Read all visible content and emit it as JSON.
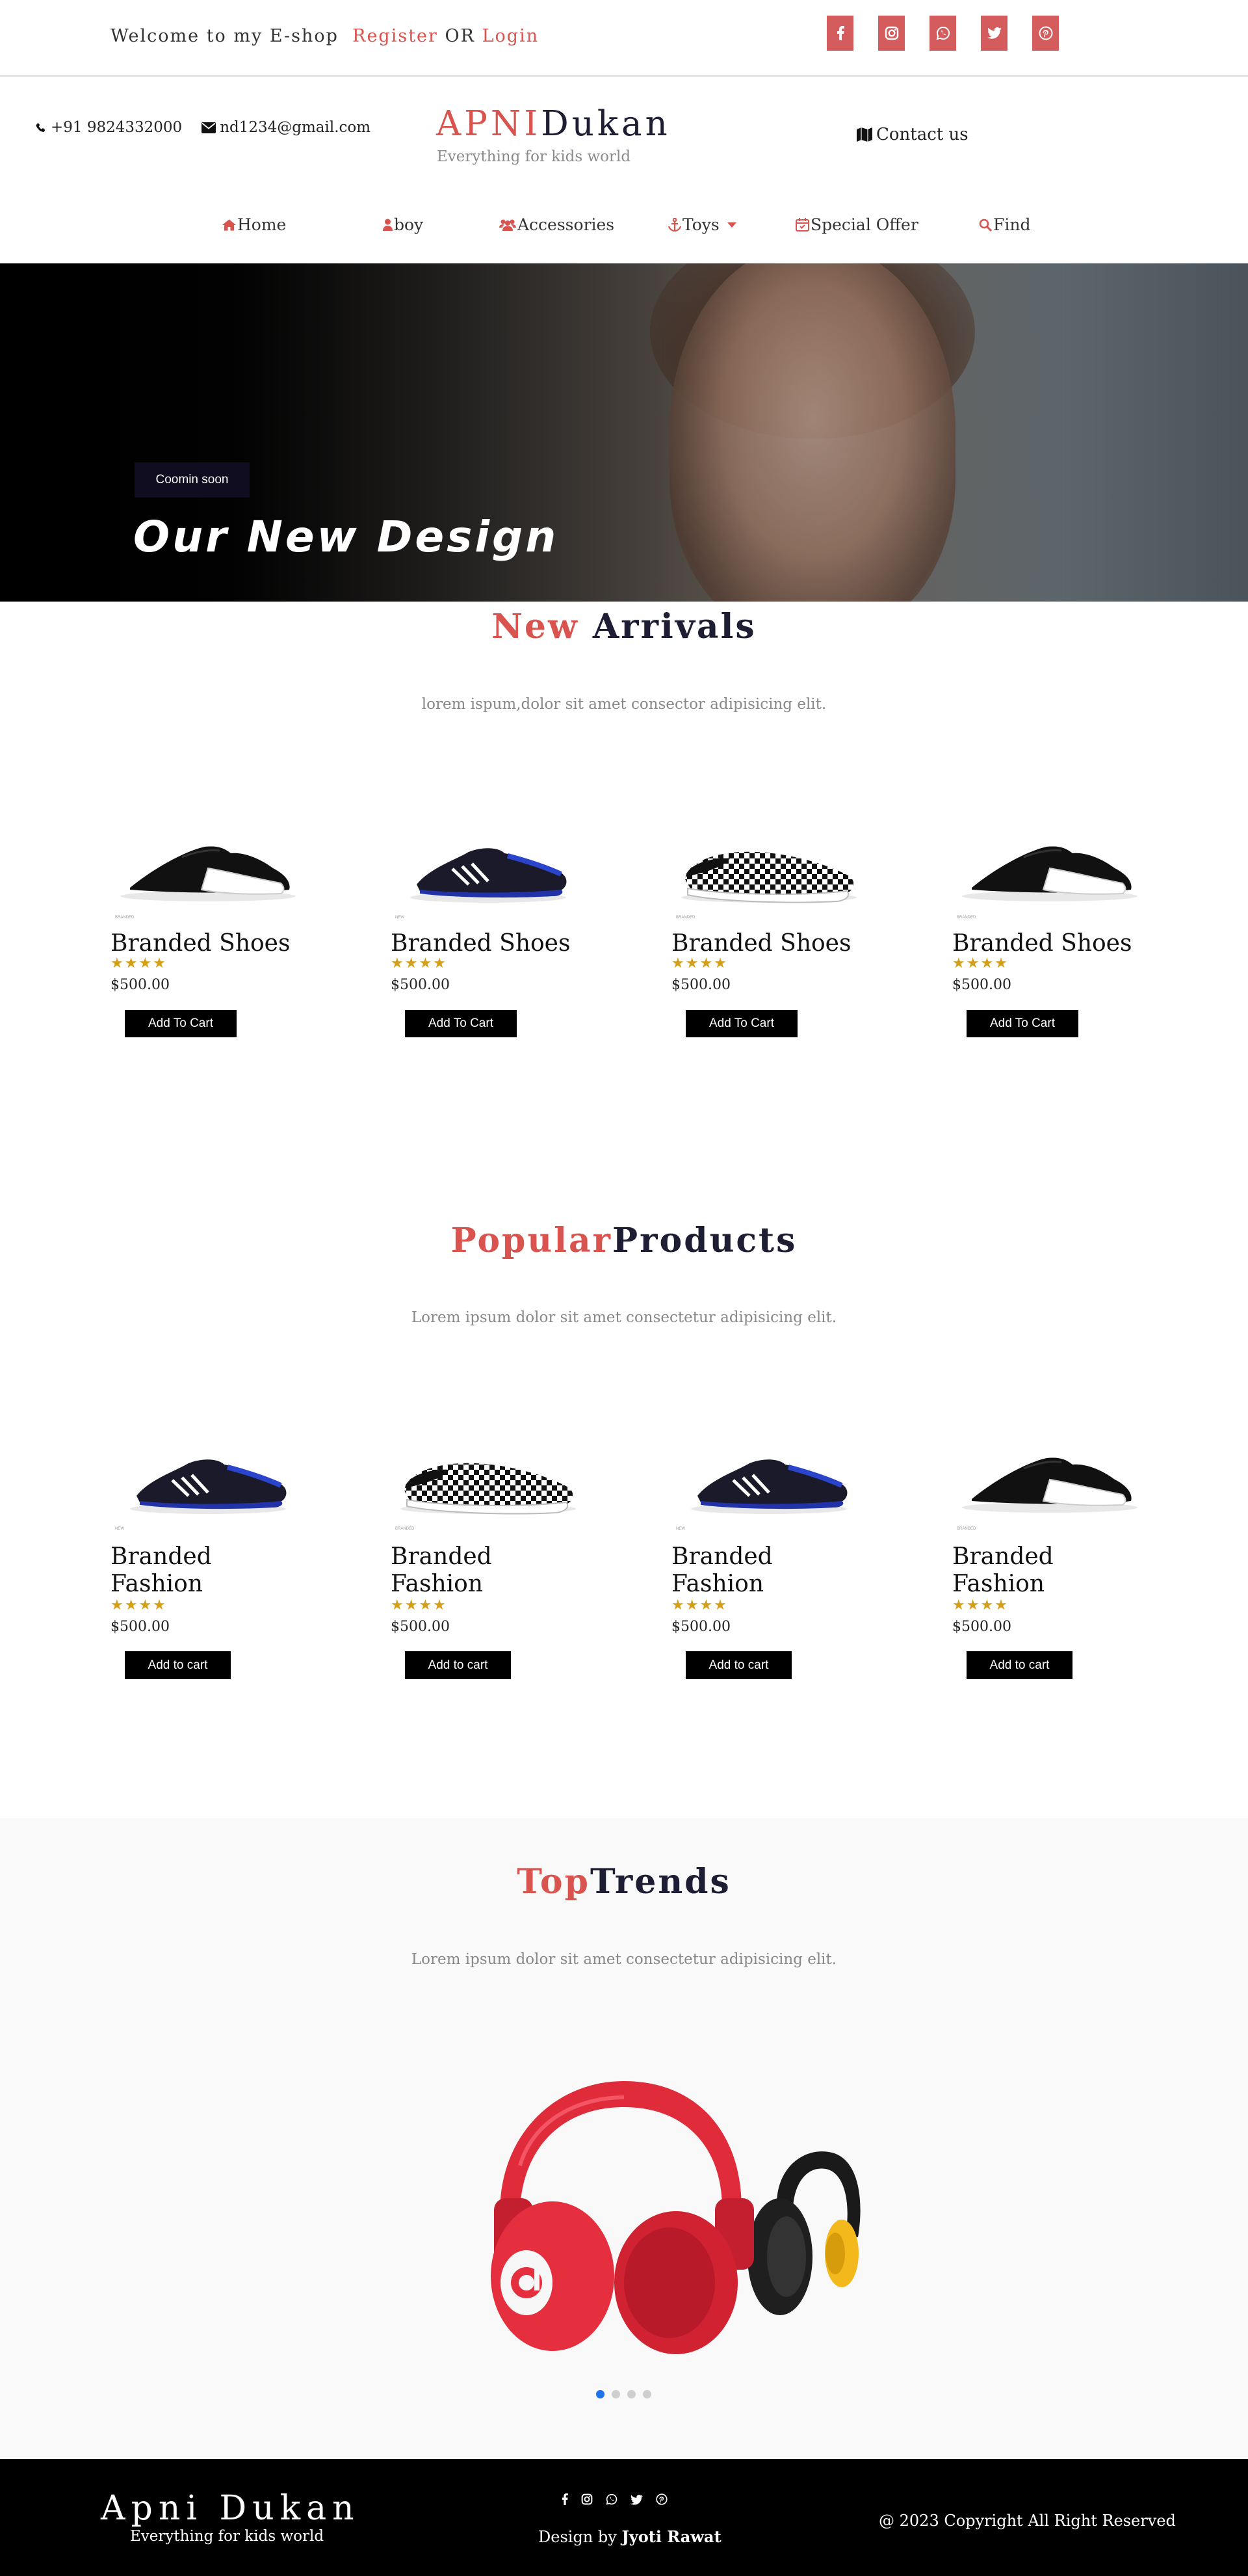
{
  "topbar": {
    "welcome": "Welcome to my E-shop",
    "register": "Register",
    "or": "OR",
    "login": "Login",
    "social_icons": [
      "facebook-icon",
      "instagram-icon",
      "whatsapp-icon",
      "twitter-icon",
      "pinterest-icon"
    ],
    "accent_color": "#d45c5c"
  },
  "header": {
    "phone": "+91 9824332000",
    "email": "nd1234@gmail.com",
    "logo_part1": "APNI",
    "logo_part2": "Dukan",
    "tagline": "Everything for kids world",
    "contact": "Contact us"
  },
  "nav": {
    "items": [
      {
        "label": "Home",
        "icon": "home-icon"
      },
      {
        "label": "boy",
        "icon": "user-icon"
      },
      {
        "label": "Accessories",
        "icon": "users-icon"
      },
      {
        "label": "Toys",
        "icon": "anchor-icon"
      },
      {
        "label": "Special Offer",
        "icon": "calendar-icon"
      },
      {
        "label": "Find",
        "icon": "search-icon"
      }
    ]
  },
  "hero": {
    "badge": "Coomin soon",
    "headline": "Our New Design"
  },
  "new_arrivals": {
    "title_a": "New",
    "title_b": " Arrivals",
    "subtitle": "lorem ispum,dolor sit amet consector adipisicing elit.",
    "products": [
      {
        "name": "Branded Shoes",
        "price": "$500.00",
        "button": "Add To Cart",
        "rating": 4,
        "image": "black-slipon-shoe"
      },
      {
        "name": "Branded Shoes",
        "price": "$500.00",
        "button": "Add To Cart",
        "rating": 4,
        "image": "blue-sneaker"
      },
      {
        "name": "Branded Shoes",
        "price": "$500.00",
        "button": "Add To Cart",
        "rating": 4,
        "image": "checkered-slipon"
      },
      {
        "name": "Branded Shoes",
        "price": "$500.00",
        "button": "Add To Cart",
        "rating": 4,
        "image": "black-slipon-shoe"
      }
    ]
  },
  "popular": {
    "title_a": "Popular",
    "title_b": "Products",
    "subtitle": "Lorem ipsum dolor sit amet consectetur adipisicing elit.",
    "products": [
      {
        "name_line1": "Branded",
        "name_line2": "Fashion",
        "price": "$500.00",
        "button": "Add to cart",
        "rating": 4,
        "image": "blue-sneaker"
      },
      {
        "name_line1": "Branded",
        "name_line2": "Fashion",
        "price": "$500.00",
        "button": "Add to cart",
        "rating": 4,
        "image": "checkered-slipon"
      },
      {
        "name_line1": "Branded",
        "name_line2": "Fashion",
        "price": "$500.00",
        "button": "Add to cart",
        "rating": 4,
        "image": "blue-sneaker"
      },
      {
        "name_line1": "Branded",
        "name_line2": "Fashion",
        "price": "$500.00",
        "button": "Add to cart",
        "rating": 4,
        "image": "black-slipon-shoe"
      }
    ]
  },
  "trends": {
    "title_a": "Top",
    "title_b": "Trends",
    "subtitle": "Lorem ipsum dolor sit amet consectetur adipisicing elit.",
    "slide_count": 4,
    "active_slide": 1
  },
  "footer": {
    "brand": "Apni Dukan",
    "tagline": "Everything for kids world",
    "social_icons": [
      "facebook-icon",
      "instagram-icon",
      "whatsapp-icon",
      "twitter-icon",
      "pinterest-icon"
    ],
    "design_prefix": "Design by ",
    "designer": "Jyoti Rawat",
    "copyright": "@ 2023 Copyright All Right Reserved"
  }
}
